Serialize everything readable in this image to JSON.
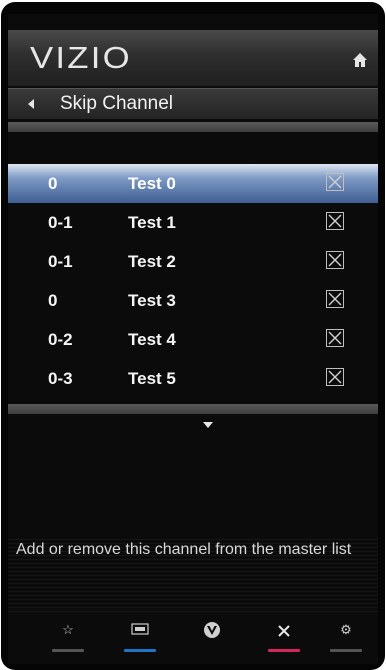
{
  "app": {
    "logo": "VIZIO"
  },
  "header": {
    "title": "Skip Channel"
  },
  "channels": [
    {
      "number": "0",
      "name": "Test 0",
      "selected": true
    },
    {
      "number": "0-1",
      "name": "Test 1",
      "selected": false
    },
    {
      "number": "0-1",
      "name": "Test 2",
      "selected": false
    },
    {
      "number": "0",
      "name": "Test 3",
      "selected": false
    },
    {
      "number": "0-2",
      "name": "Test 4",
      "selected": false
    },
    {
      "number": "0-3",
      "name": "Test 5",
      "selected": false
    }
  ],
  "help_text": "Add or remove this channel from the master list",
  "bottom_buttons": [
    {
      "icon": "star-icon",
      "color": "#555555"
    },
    {
      "icon": "input-icon",
      "color": "#1f74c9"
    },
    {
      "icon": "vizio-v-icon",
      "color": "#0b0b0b"
    },
    {
      "icon": "close-icon",
      "color": "#d4265a"
    },
    {
      "icon": "gear-icon",
      "color": "#555555"
    }
  ]
}
